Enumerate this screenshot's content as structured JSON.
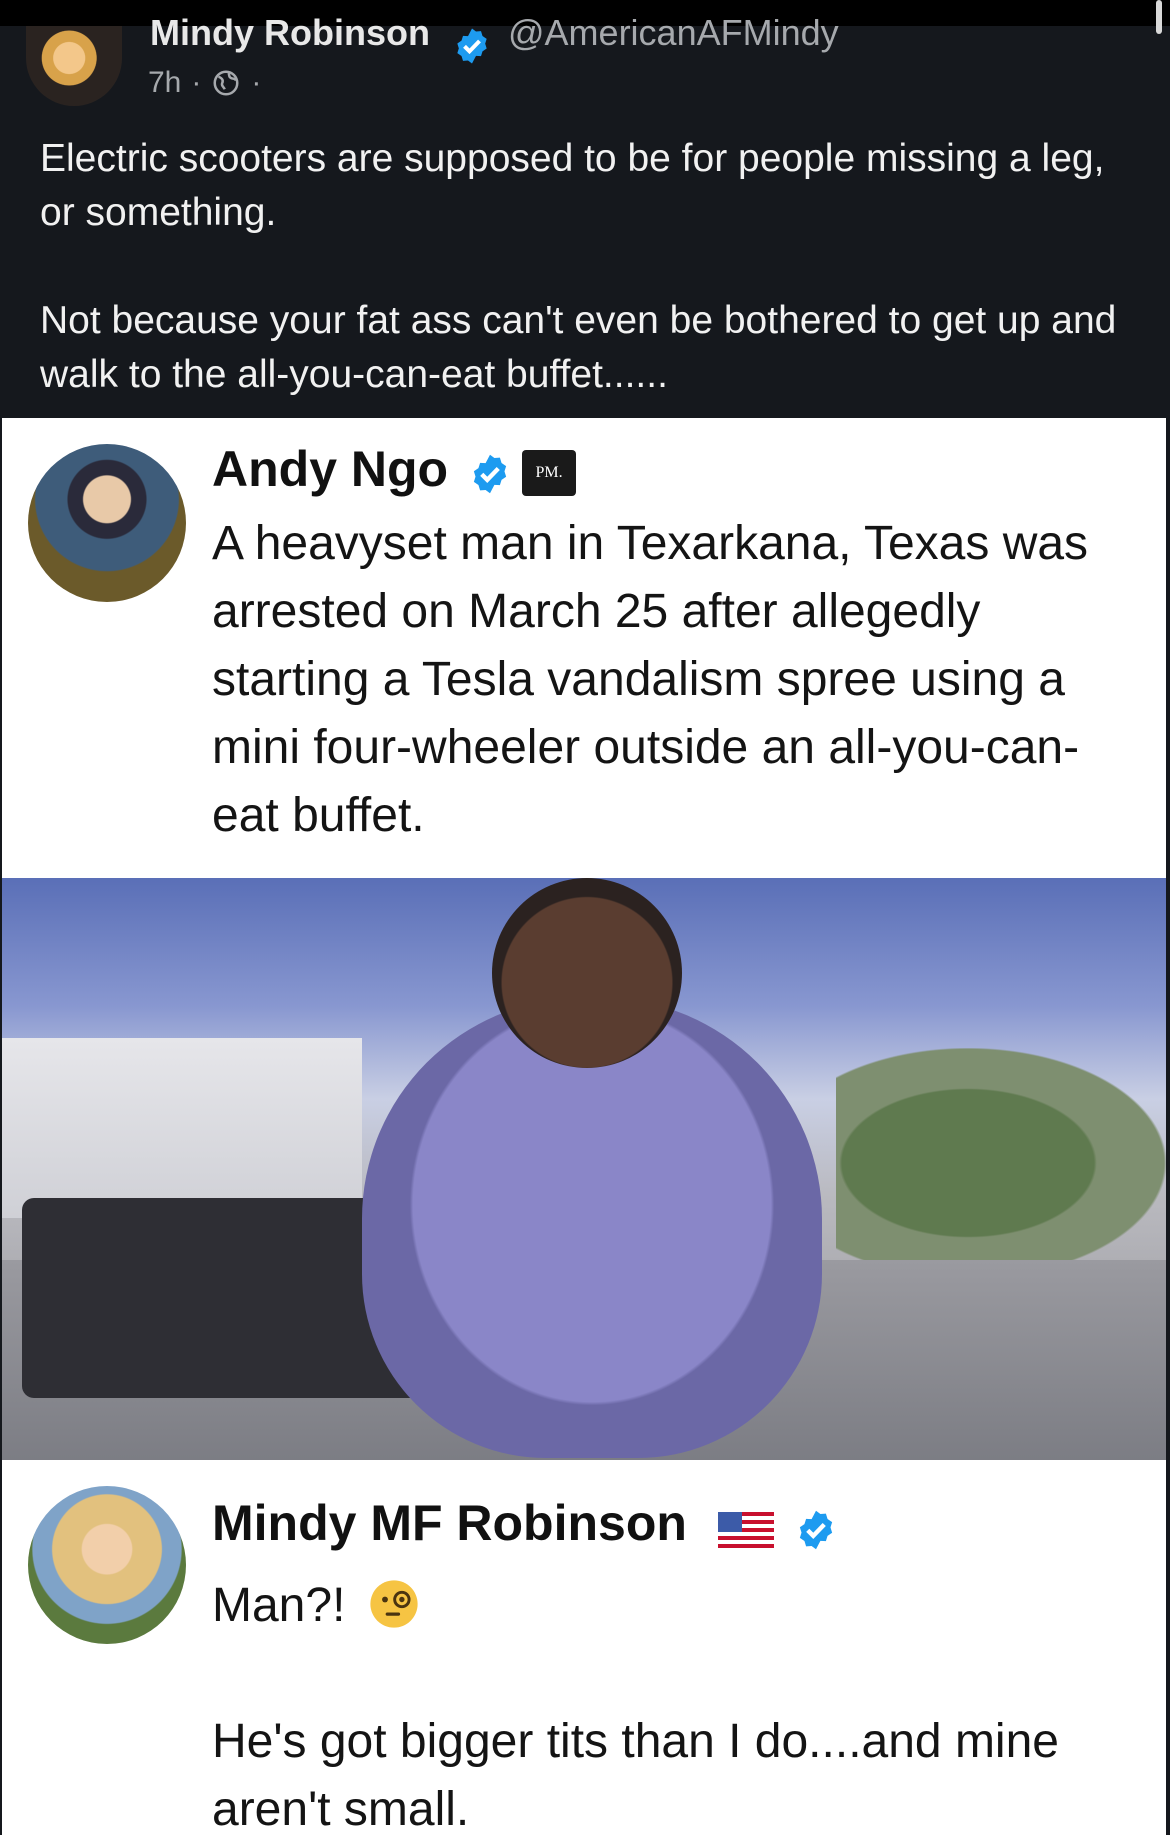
{
  "post": {
    "author_name": "Mindy Robinson",
    "handle": "@AmericanAFMindy",
    "time": "7h",
    "separator": "·",
    "body_line1": "Electric scooters are supposed to be for people missing a leg, or something.",
    "body_line2": "Not because your fat ass can't even be bothered to get up and walk to the all-you-can-eat buffet......"
  },
  "embed": {
    "tweet1": {
      "author_name": "Andy Ngo",
      "badge": "PM.",
      "text": "A heavyset man in Texarkana, Texas was arrested on March 25 after allegedly starting a Tesla vandalism spree using a mini four-wheeler outside an all-you-can-eat buffet."
    },
    "tweet2": {
      "author_name": "Mindy MF Robinson",
      "text1": "Man?!",
      "text2": "He's got bigger tits than I do....and mine aren't small."
    }
  },
  "colors": {
    "background": "#15181d",
    "verified": "#1d9bf0"
  },
  "icons": [
    "verified-badge-icon",
    "globe-icon",
    "us-flag-icon",
    "monocle-face-icon"
  ]
}
